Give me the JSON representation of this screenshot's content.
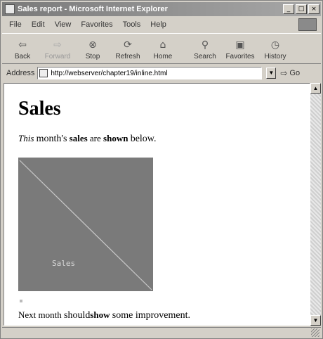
{
  "window": {
    "title": "Sales report - Microsoft Internet Explorer",
    "controls": {
      "minimize": "_",
      "maximize": "□",
      "close": "×"
    }
  },
  "menu": {
    "items": [
      "File",
      "Edit",
      "View",
      "Favorites",
      "Tools",
      "Help"
    ]
  },
  "toolbar": {
    "back": "Back",
    "forward": "Forward",
    "stop": "Stop",
    "refresh": "Refresh",
    "home": "Home",
    "search": "Search",
    "favorites": "Favorites",
    "history": "History"
  },
  "address": {
    "label": "Address",
    "url": "http://webserver/chapter19/inline.html",
    "go": "Go"
  },
  "page": {
    "heading": "Sales",
    "line1": {
      "this": "This",
      "months": "month's",
      "sales": "sales",
      "are": "are",
      "shown": "shown",
      "below": "below."
    },
    "image_label": "Sales",
    "line2": {
      "next_month": "Next month",
      "should": "should",
      "show": "show",
      "some_improvement": "some improvement."
    }
  },
  "icons": {
    "back": "back-arrow-icon",
    "forward": "forward-arrow-icon",
    "stop": "stop-icon",
    "refresh": "refresh-icon",
    "home": "home-icon",
    "search": "search-icon",
    "favorites": "favorites-icon",
    "history": "history-icon"
  }
}
